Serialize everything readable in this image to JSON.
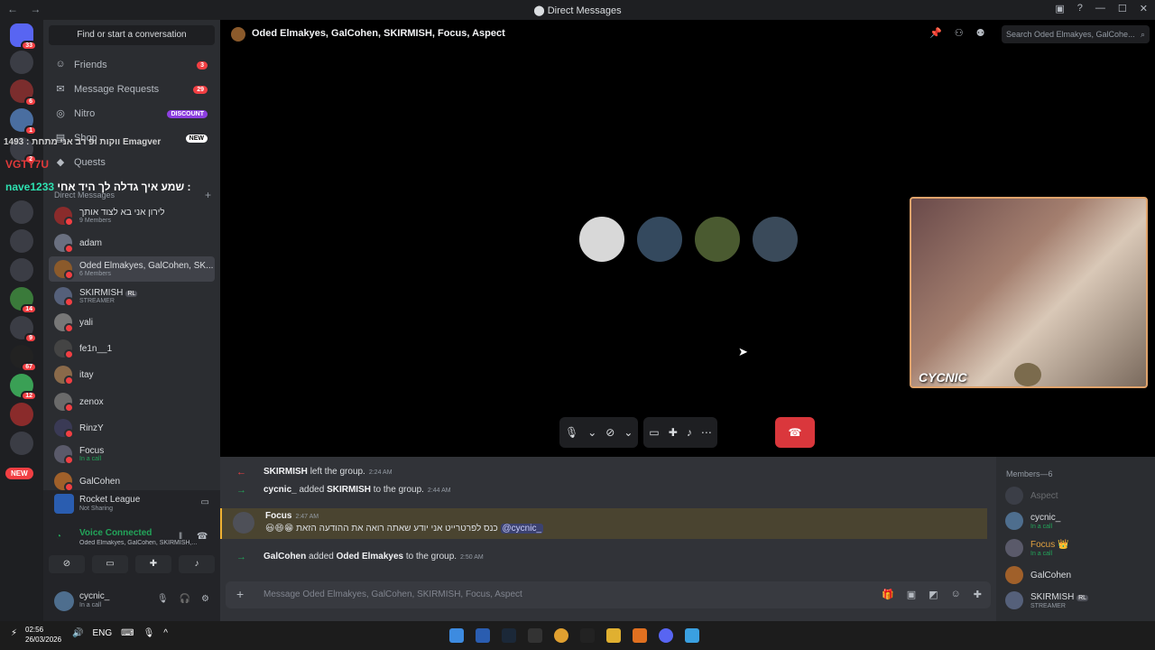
{
  "window": {
    "title": "Direct Messages",
    "back": "←",
    "forward": "→"
  },
  "guilds": {
    "badges": [
      "33",
      "6",
      "1",
      "2",
      "",
      "",
      "",
      "14",
      "9",
      "67",
      "12",
      "",
      ""
    ],
    "new_label": "NEW"
  },
  "sidebar": {
    "search": "Find or start a conversation",
    "nav": [
      {
        "label": "Friends",
        "count": "3"
      },
      {
        "label": "Message Requests",
        "count": "29"
      },
      {
        "label": "Nitro",
        "count": "DISCOUNT"
      },
      {
        "label": "Shop",
        "count": "NEW"
      },
      {
        "label": "Quests",
        "count": ""
      }
    ],
    "dm_header": "Direct Messages",
    "overlay": {
      "line1": "ווקות ופ רב אני מתחת : 1493 Emagver",
      "line2_name": "VGTY7U",
      "line3_msg": "שמע איך גדלה לך היד אחי :",
      "line3_name": "nave1233"
    },
    "dms": [
      {
        "name": "לירון אני בא לצוד אותך",
        "sub": "9 Members"
      },
      {
        "name": "adam",
        "sub": ""
      },
      {
        "name": "Oded Elmakyes, GalCohen, SK...",
        "sub": "6 Members"
      },
      {
        "name": "SKIRMISH",
        "tag": "RL",
        "sub": "STREAMER"
      },
      {
        "name": "yali",
        "sub": ""
      },
      {
        "name": "fe1n__1",
        "sub": ""
      },
      {
        "name": "itay",
        "sub": ""
      },
      {
        "name": "zenox",
        "sub": ""
      },
      {
        "name": "RinzY",
        "sub": ""
      },
      {
        "name": "Focus",
        "sub": "In a call"
      },
      {
        "name": "GalCohen",
        "sub": ""
      }
    ]
  },
  "activity": {
    "game": "Rocket League",
    "status": "Not Sharing"
  },
  "voice": {
    "status": "Voice Connected",
    "channel": "Oded Elmakyes, GalCohen, SKIRMISH,..."
  },
  "user": {
    "name": "cycnic_",
    "status": "In a call"
  },
  "header": {
    "title": "Oded Elmakyes, GalCohen, SKIRMISH, Focus, Aspect",
    "search_placeholder": "Search Oded Elmakyes, GalCohe..."
  },
  "webcam": {
    "label": "CYCNIC"
  },
  "messages": [
    {
      "type": "system",
      "arrow": "←",
      "actor": "SKIRMISH",
      "text": "left the group.",
      "time": "2:24 AM"
    },
    {
      "type": "system",
      "arrow": "→",
      "actor": "cycnic_",
      "text": "added",
      "target": "SKIRMISH",
      "tail": "to the group.",
      "time": "2:44 AM"
    },
    {
      "type": "message",
      "author": "Focus",
      "time": "2:47 AM",
      "text": "😃😄😁 כנס לפרטרייט אני יודע שאתה רואה את ההודעה הזאת",
      "mention": "@cycnic_"
    },
    {
      "type": "system",
      "arrow": "→",
      "actor": "GalCohen",
      "text": "added",
      "target": "Oded Elmakyes",
      "tail": "to the group.",
      "time": "2:50 AM"
    }
  ],
  "composer": {
    "placeholder": "Message Oded Elmakyes, GalCohen, SKIRMISH, Focus, Aspect"
  },
  "members": {
    "header": "Members—6",
    "list": [
      {
        "name": "Aspect",
        "sub": ""
      },
      {
        "name": "cycnic_",
        "sub": "In a call"
      },
      {
        "name": "Focus 👑",
        "sub": "In a call"
      },
      {
        "name": "GalCohen",
        "sub": ""
      },
      {
        "name": "SKIRMISH",
        "tag": "RL",
        "sub": "STREAMER"
      }
    ]
  },
  "taskbar": {
    "time": "02:56",
    "date": "26/03/2026",
    "lang": "ENG"
  },
  "colors": {
    "danger": "#da373c",
    "online": "#23a55a",
    "blurple": "#5865f2",
    "highlight": "#f0b232"
  }
}
